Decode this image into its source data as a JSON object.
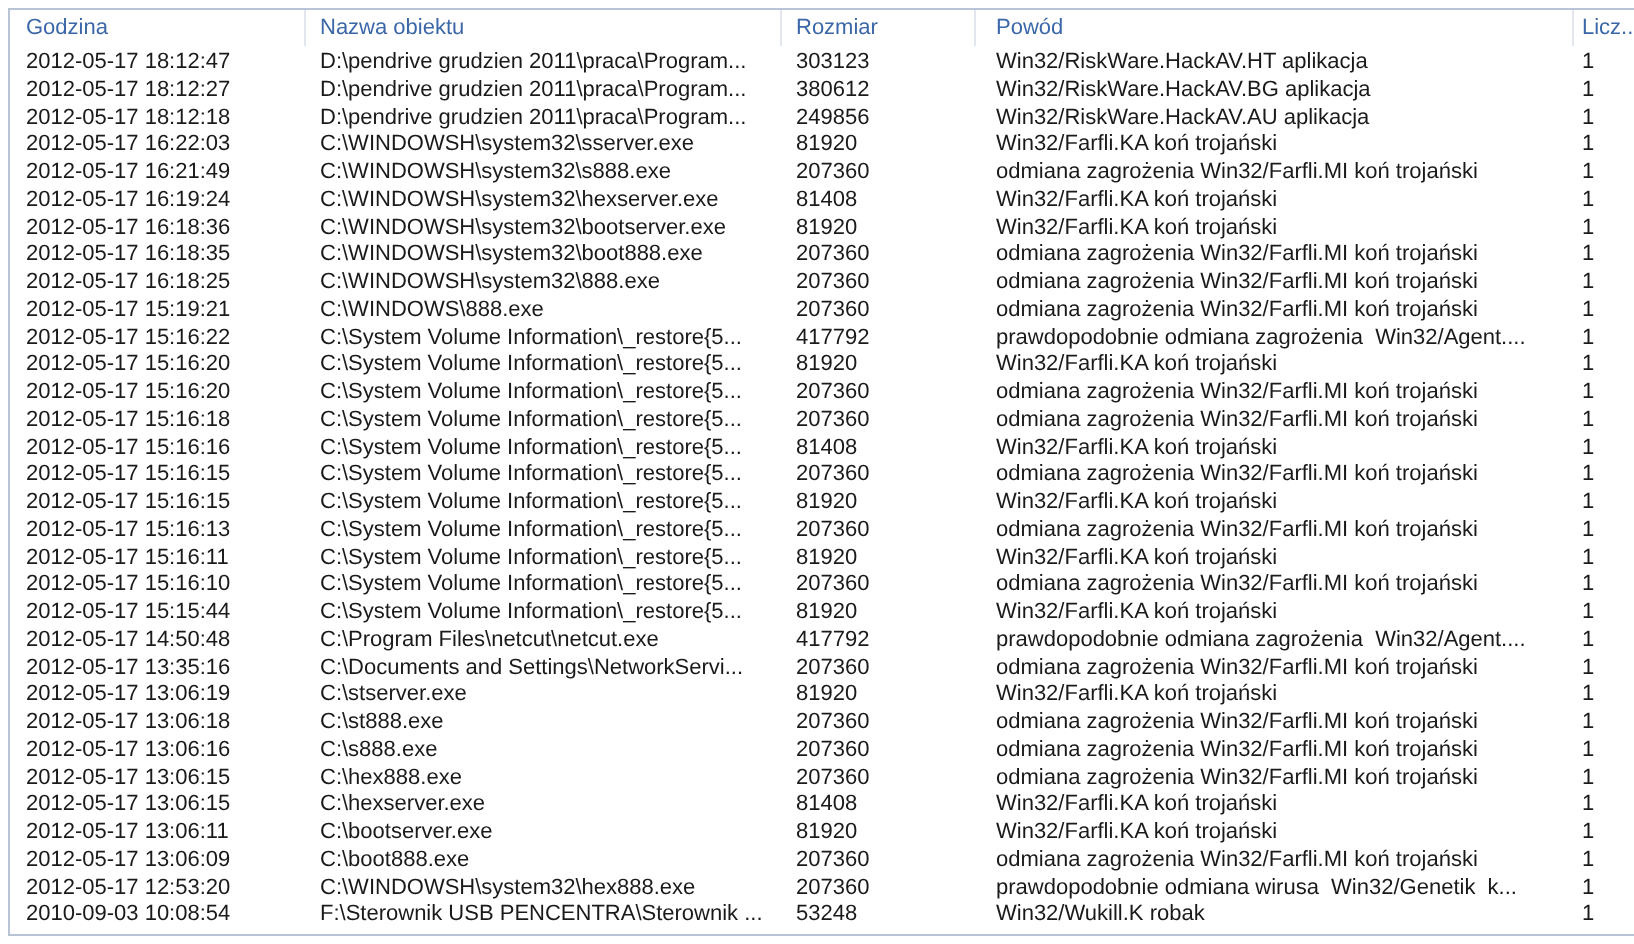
{
  "table": {
    "columns": [
      "Godzina",
      "Nazwa obiektu",
      "Rozmiar",
      "Powód",
      "Licz..."
    ],
    "rows": [
      [
        "2012-05-17 18:12:47",
        "D:\\pendrive grudzien 2011\\praca\\Program...",
        "303123",
        "Win32/RiskWare.HackAV.HT aplikacja",
        "1"
      ],
      [
        "2012-05-17 18:12:27",
        "D:\\pendrive grudzien 2011\\praca\\Program...",
        "380612",
        "Win32/RiskWare.HackAV.BG aplikacja",
        "1"
      ],
      [
        "2012-05-17 18:12:18",
        "D:\\pendrive grudzien 2011\\praca\\Program...",
        "249856",
        "Win32/RiskWare.HackAV.AU aplikacja",
        "1"
      ],
      [
        "2012-05-17 16:22:03",
        "C:\\WINDOWSH\\system32\\sserver.exe",
        "81920",
        "Win32/Farfli.KA koń trojański",
        "1"
      ],
      [
        "2012-05-17 16:21:49",
        "C:\\WINDOWSH\\system32\\s888.exe",
        "207360",
        "odmiana zagrożenia Win32/Farfli.MI koń trojański",
        "1"
      ],
      [
        "2012-05-17 16:19:24",
        "C:\\WINDOWSH\\system32\\hexserver.exe",
        "81408",
        "Win32/Farfli.KA koń trojański",
        "1"
      ],
      [
        "2012-05-17 16:18:36",
        "C:\\WINDOWSH\\system32\\bootserver.exe",
        "81920",
        "Win32/Farfli.KA koń trojański",
        "1"
      ],
      [
        "2012-05-17 16:18:35",
        "C:\\WINDOWSH\\system32\\boot888.exe",
        "207360",
        "odmiana zagrożenia Win32/Farfli.MI koń trojański",
        "1"
      ],
      [
        "2012-05-17 16:18:25",
        "C:\\WINDOWSH\\system32\\888.exe",
        "207360",
        "odmiana zagrożenia Win32/Farfli.MI koń trojański",
        "1"
      ],
      [
        "2012-05-17 15:19:21",
        "C:\\WINDOWS\\888.exe",
        "207360",
        "odmiana zagrożenia Win32/Farfli.MI koń trojański",
        "1"
      ],
      [
        "2012-05-17 15:16:22",
        "C:\\System Volume Information\\_restore{5...",
        "417792",
        "prawdopodobnie odmiana zagrożenia  Win32/Agent....",
        "1"
      ],
      [
        "2012-05-17 15:16:20",
        "C:\\System Volume Information\\_restore{5...",
        "81920",
        "Win32/Farfli.KA koń trojański",
        "1"
      ],
      [
        "2012-05-17 15:16:20",
        "C:\\System Volume Information\\_restore{5...",
        "207360",
        "odmiana zagrożenia Win32/Farfli.MI koń trojański",
        "1"
      ],
      [
        "2012-05-17 15:16:18",
        "C:\\System Volume Information\\_restore{5...",
        "207360",
        "odmiana zagrożenia Win32/Farfli.MI koń trojański",
        "1"
      ],
      [
        "2012-05-17 15:16:16",
        "C:\\System Volume Information\\_restore{5...",
        "81408",
        "Win32/Farfli.KA koń trojański",
        "1"
      ],
      [
        "2012-05-17 15:16:15",
        "C:\\System Volume Information\\_restore{5...",
        "207360",
        "odmiana zagrożenia Win32/Farfli.MI koń trojański",
        "1"
      ],
      [
        "2012-05-17 15:16:15",
        "C:\\System Volume Information\\_restore{5...",
        "81920",
        "Win32/Farfli.KA koń trojański",
        "1"
      ],
      [
        "2012-05-17 15:16:13",
        "C:\\System Volume Information\\_restore{5...",
        "207360",
        "odmiana zagrożenia Win32/Farfli.MI koń trojański",
        "1"
      ],
      [
        "2012-05-17 15:16:11",
        "C:\\System Volume Information\\_restore{5...",
        "81920",
        "Win32/Farfli.KA koń trojański",
        "1"
      ],
      [
        "2012-05-17 15:16:10",
        "C:\\System Volume Information\\_restore{5...",
        "207360",
        "odmiana zagrożenia Win32/Farfli.MI koń trojański",
        "1"
      ],
      [
        "2012-05-17 15:15:44",
        "C:\\System Volume Information\\_restore{5...",
        "81920",
        "Win32/Farfli.KA koń trojański",
        "1"
      ],
      [
        "2012-05-17 14:50:48",
        "C:\\Program Files\\netcut\\netcut.exe",
        "417792",
        "prawdopodobnie odmiana zagrożenia  Win32/Agent....",
        "1"
      ],
      [
        "2012-05-17 13:35:16",
        "C:\\Documents and Settings\\NetworkServi...",
        "207360",
        "odmiana zagrożenia Win32/Farfli.MI koń trojański",
        "1"
      ],
      [
        "2012-05-17 13:06:19",
        "C:\\stserver.exe",
        "81920",
        "Win32/Farfli.KA koń trojański",
        "1"
      ],
      [
        "2012-05-17 13:06:18",
        "C:\\st888.exe",
        "207360",
        "odmiana zagrożenia Win32/Farfli.MI koń trojański",
        "1"
      ],
      [
        "2012-05-17 13:06:16",
        "C:\\s888.exe",
        "207360",
        "odmiana zagrożenia Win32/Farfli.MI koń trojański",
        "1"
      ],
      [
        "2012-05-17 13:06:15",
        "C:\\hex888.exe",
        "207360",
        "odmiana zagrożenia Win32/Farfli.MI koń trojański",
        "1"
      ],
      [
        "2012-05-17 13:06:15",
        "C:\\hexserver.exe",
        "81408",
        "Win32/Farfli.KA koń trojański",
        "1"
      ],
      [
        "2012-05-17 13:06:11",
        "C:\\bootserver.exe",
        "81920",
        "Win32/Farfli.KA koń trojański",
        "1"
      ],
      [
        "2012-05-17 13:06:09",
        "C:\\boot888.exe",
        "207360",
        "odmiana zagrożenia Win32/Farfli.MI koń trojański",
        "1"
      ],
      [
        "2012-05-17 12:53:20",
        "C:\\WINDOWSH\\system32\\hex888.exe",
        "207360",
        "prawdopodobnie odmiana wirusa  Win32/Genetik  k...",
        "1"
      ],
      [
        "2010-09-03 10:08:54",
        "F:\\Sterownik USB PENCENTRA\\Sterownik ...",
        "53248",
        "Win32/Wukill.K robak",
        "1"
      ]
    ]
  }
}
